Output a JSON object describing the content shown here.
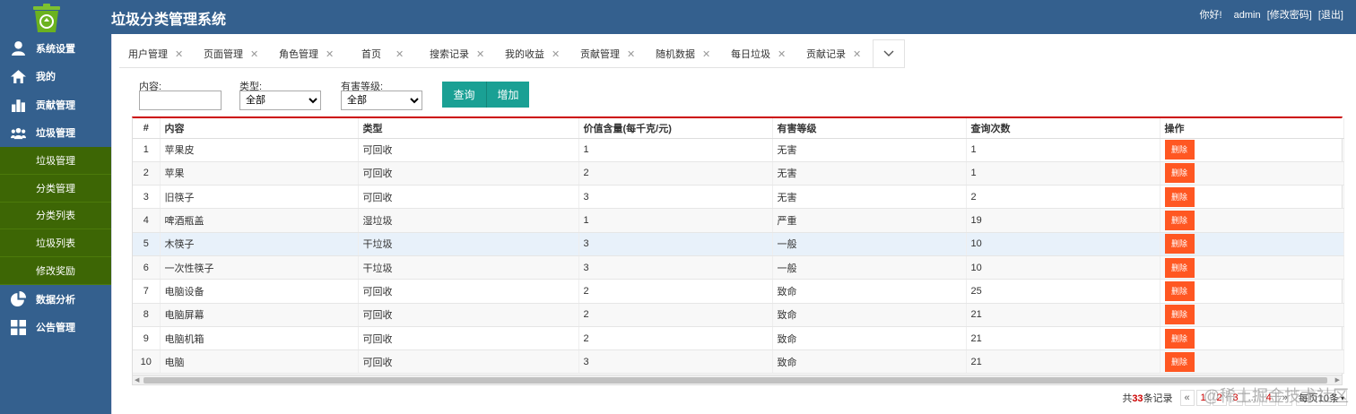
{
  "app": {
    "title": "垃圾分类管理系统"
  },
  "user_bar": {
    "greeting": "你好!",
    "username": "admin",
    "change_password": "[修改密码]",
    "logout": "[退出]"
  },
  "sidebar": {
    "items": [
      {
        "label": "系统设置",
        "icon": "user-icon"
      },
      {
        "label": "我的",
        "icon": "home-icon"
      },
      {
        "label": "贡献管理",
        "icon": "bar-chart-icon"
      },
      {
        "label": "垃圾管理",
        "icon": "group-icon"
      }
    ],
    "sub_items": [
      {
        "label": "垃圾管理"
      },
      {
        "label": "分类管理"
      },
      {
        "label": "分类列表"
      },
      {
        "label": "垃圾列表"
      },
      {
        "label": "修改奖励"
      }
    ],
    "bottom_items": [
      {
        "label": "数据分析",
        "icon": "pie-chart-icon"
      },
      {
        "label": "公告管理",
        "icon": "grid-icon"
      }
    ]
  },
  "tabs": [
    {
      "label": "用户管理"
    },
    {
      "label": "页面管理"
    },
    {
      "label": "角色管理"
    },
    {
      "label": "首页"
    },
    {
      "label": "搜索记录"
    },
    {
      "label": "我的收益"
    },
    {
      "label": "贡献管理"
    },
    {
      "label": "随机数据"
    },
    {
      "label": "每日垃圾"
    },
    {
      "label": "贡献记录"
    }
  ],
  "filters": {
    "content_label": "内容:",
    "content_value": "",
    "type_label": "类型:",
    "type_selected": "全部",
    "harm_label": "有害等级:",
    "harm_selected": "全部",
    "query_button": "查询",
    "add_button": "增加"
  },
  "table": {
    "headers": [
      "#",
      "内容",
      "类型",
      "价值含量(每千克/元)",
      "有害等级",
      "查询次数",
      "操作"
    ],
    "delete_label": "删除",
    "rows": [
      {
        "no": "1",
        "content": "苹果皮",
        "type": "可回收",
        "value": "1",
        "harm": "无害",
        "queries": "1"
      },
      {
        "no": "2",
        "content": "苹果",
        "type": "可回收",
        "value": "2",
        "harm": "无害",
        "queries": "1"
      },
      {
        "no": "3",
        "content": "旧筷子",
        "type": "可回收",
        "value": "3",
        "harm": "无害",
        "queries": "2"
      },
      {
        "no": "4",
        "content": "啤酒瓶盖",
        "type": "湿垃圾",
        "value": "1",
        "harm": "严重",
        "queries": "19"
      },
      {
        "no": "5",
        "content": "木筷子",
        "type": "干垃圾",
        "value": "3",
        "harm": "一般",
        "queries": "10"
      },
      {
        "no": "6",
        "content": "一次性筷子",
        "type": "干垃圾",
        "value": "3",
        "harm": "一般",
        "queries": "10"
      },
      {
        "no": "7",
        "content": "电脑设备",
        "type": "可回收",
        "value": "2",
        "harm": "致命",
        "queries": "25"
      },
      {
        "no": "8",
        "content": "电脑屏幕",
        "type": "可回收",
        "value": "2",
        "harm": "致命",
        "queries": "21"
      },
      {
        "no": "9",
        "content": "电脑机箱",
        "type": "可回收",
        "value": "2",
        "harm": "致命",
        "queries": "21"
      },
      {
        "no": "10",
        "content": "电脑",
        "type": "可回收",
        "value": "3",
        "harm": "致命",
        "queries": "21"
      }
    ]
  },
  "pager": {
    "total_prefix": "共",
    "total_count": "33",
    "total_suffix": "条记录",
    "prev": "«",
    "pages": [
      "1",
      "2",
      "3",
      "...",
      "4",
      "»"
    ],
    "page_size": "每页10条"
  },
  "watermark": "@稀土掘金技术社区"
}
